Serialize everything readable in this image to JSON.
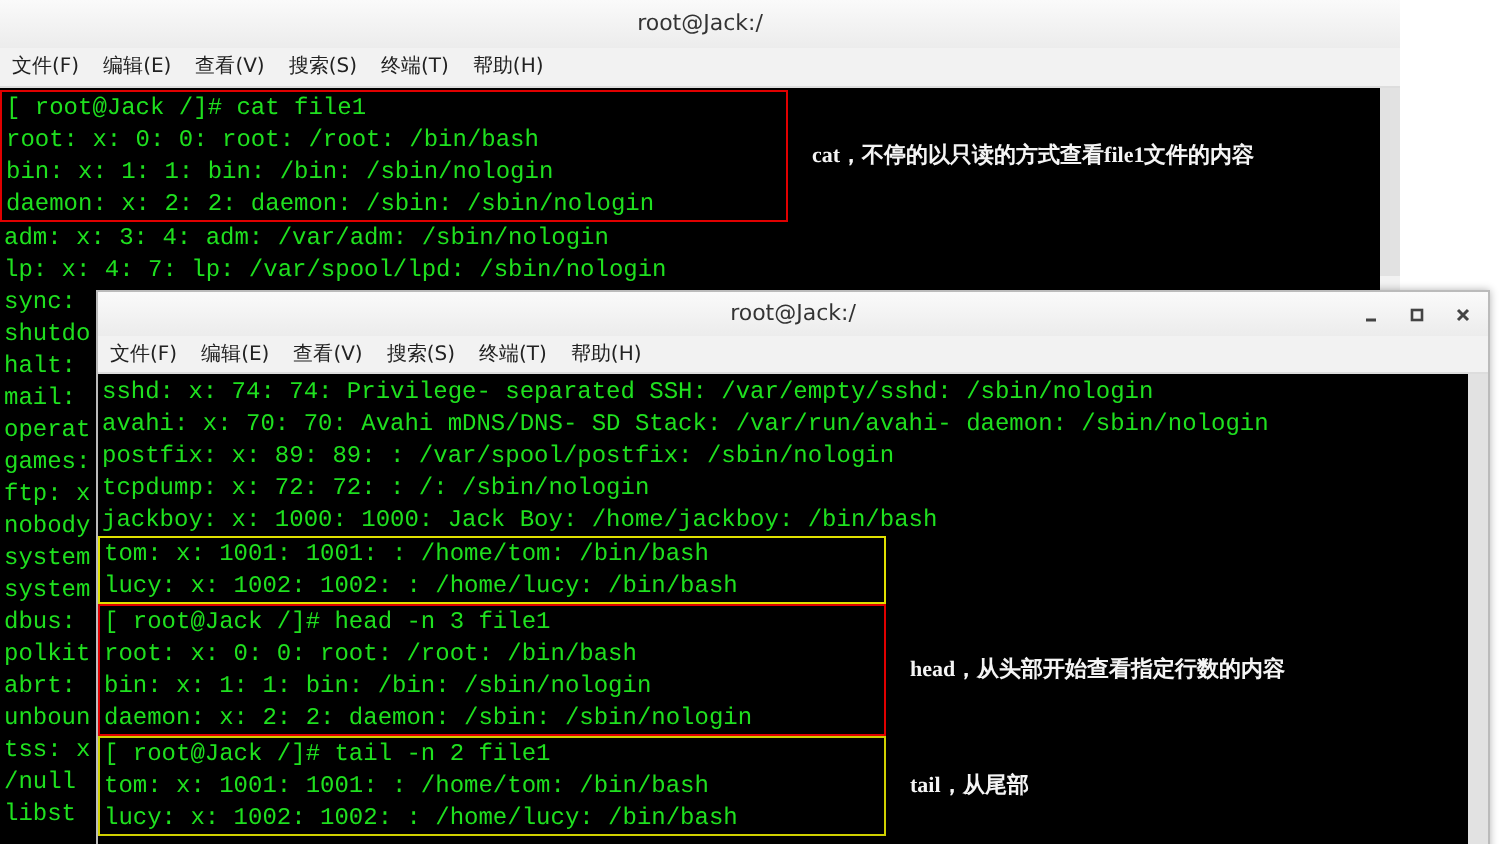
{
  "windows": [
    {
      "title": "root@Jack:/",
      "controls": false,
      "menu": [
        "文件(F)",
        "编辑(E)",
        "查看(V)",
        "搜索(S)",
        "终端(T)",
        "帮助(H)"
      ],
      "blocks": [
        {
          "color": "#e00000",
          "note": "cat，不停的以只读的方式查看file1文件的内容",
          "lines": [
            "[ root@Jack /]# cat file1",
            "root: x: 0: 0: root: /root: /bin/bash",
            "bin: x: 1: 1: bin: /bin: /sbin/nologin",
            "daemon: x: 2: 2: daemon: /sbin: /sbin/nologin"
          ]
        },
        {
          "lines": [
            "adm: x: 3: 4: adm: /var/adm: /sbin/nologin",
            "lp: x: 4: 7: lp: /var/spool/lpd: /sbin/nologin",
            "sync:",
            "shutdo",
            "halt:",
            "mail:",
            "operat",
            "games:",
            "ftp: x",
            "nobody",
            "system",
            "system",
            "dbus:",
            "polkit",
            "abrt:",
            "unboun",
            "tss: x",
            "/null",
            "libst"
          ]
        }
      ]
    },
    {
      "title": "root@Jack:/",
      "controls": true,
      "menu": [
        "文件(F)",
        "编辑(E)",
        "查看(V)",
        "搜索(S)",
        "终端(T)",
        "帮助(H)"
      ],
      "blocks": [
        {
          "lines": [
            "sshd: x: 74: 74: Privilege- separated SSH: /var/empty/sshd: /sbin/nologin",
            "avahi: x: 70: 70: Avahi mDNS/DNS- SD Stack: /var/run/avahi- daemon: /sbin/nologin",
            "postfix: x: 89: 89: : /var/spool/postfix: /sbin/nologin",
            "tcpdump: x: 72: 72: : /: /sbin/nologin",
            "jackboy: x: 1000: 1000: Jack Boy: /home/jackboy: /bin/bash"
          ]
        },
        {
          "color": "#e0e000",
          "lines": [
            "tom: x: 1001: 1001: : /home/tom: /bin/bash",
            "lucy: x: 1002: 1002: : /home/lucy: /bin/bash"
          ]
        },
        {
          "color": "#e00000",
          "note": "head，从头部开始查看指定行数的内容",
          "lines": [
            "[ root@Jack /]# head -n 3 file1",
            "root: x: 0: 0: root: /root: /bin/bash",
            "bin: x: 1: 1: bin: /bin: /sbin/nologin",
            "daemon: x: 2: 2: daemon: /sbin: /sbin/nologin"
          ]
        },
        {
          "color": "#d0d000",
          "note": "tail，从尾部",
          "lines": [
            "[ root@Jack /]# tail -n 2 file1",
            "tom: x: 1001: 1001: : /home/tom: /bin/bash",
            "lucy: x: 1002: 1002: : /home/lucy: /bin/bash"
          ]
        }
      ]
    }
  ]
}
